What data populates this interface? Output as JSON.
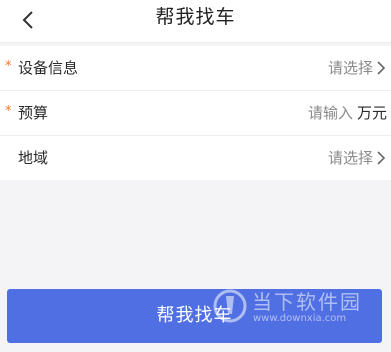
{
  "header": {
    "title": "帮我找车",
    "back_icon": "chevron-left-icon"
  },
  "form": {
    "equipment": {
      "required_mark": "*",
      "label": "设备信息",
      "value": "请选择",
      "icon": "chevron-right-icon"
    },
    "budget": {
      "required_mark": "*",
      "label": "预算",
      "placeholder": "请输入",
      "value": "",
      "unit": "万元"
    },
    "region": {
      "label": "地域",
      "value": "请选择",
      "icon": "chevron-right-icon"
    }
  },
  "submit": {
    "label": "帮我找车"
  },
  "watermark": {
    "name": "当下软件园",
    "url": "www.downxia.com",
    "icon": "downxia-logo-icon"
  },
  "colors": {
    "accent": "#4f6fe3",
    "required": "#f0772b",
    "background": "#f4f4f6",
    "placeholder": "#8a8a8a"
  }
}
